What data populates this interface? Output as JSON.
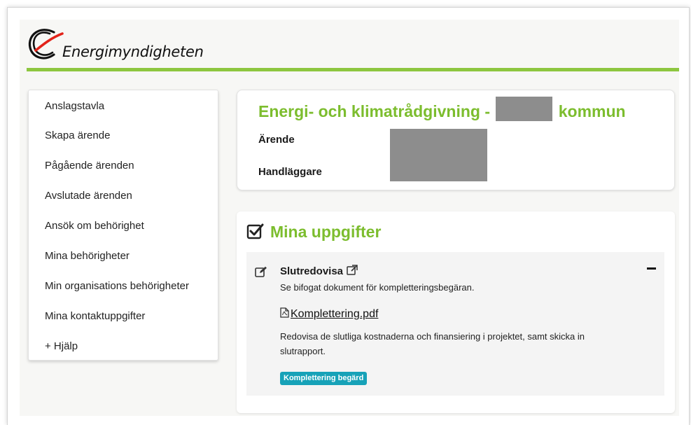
{
  "brand": {
    "name": "Energimyndigheten",
    "accent_color": "#8dc63f",
    "logo_icon": "energimyndigheten-logo-icon"
  },
  "sidebar": {
    "items": [
      {
        "label": "Anslagstavla"
      },
      {
        "label": "Skapa ärende"
      },
      {
        "label": "Pågående ärenden"
      },
      {
        "label": "Avslutade ärenden"
      },
      {
        "label": "Ansök om behörighet"
      },
      {
        "label": "Mina behörigheter"
      },
      {
        "label": "Min organisations behörigheter"
      },
      {
        "label": "Mina kontaktuppgifter"
      },
      {
        "label": "+ Hjälp"
      }
    ]
  },
  "case": {
    "title_prefix": "Energi- och klimatrådgivning -",
    "title_suffix": "kommun",
    "title_color": "#7cbd2e",
    "fields": [
      {
        "label": "Ärende"
      },
      {
        "label": "Handläggare"
      }
    ]
  },
  "tasks": {
    "heading": "Mina uppgifter",
    "heading_icon": "checkbox-checked-icon",
    "items": [
      {
        "name": "Slutredovisa",
        "name_icon": "external-link-icon",
        "edit_icon": "edit-icon",
        "description": "Se bifogat dokument för kompletteringsbegäran.",
        "attachment": {
          "filename": "Komplettering.pdf",
          "icon": "pdf-file-icon"
        },
        "note": "Redovisa de slutliga kostnaderna och finansiering i projektet, samt skicka in slutrapport.",
        "status": {
          "label": "Komplettering begärd",
          "color": "#17a2b8"
        },
        "collapse_icon": "minus-icon"
      }
    ]
  }
}
